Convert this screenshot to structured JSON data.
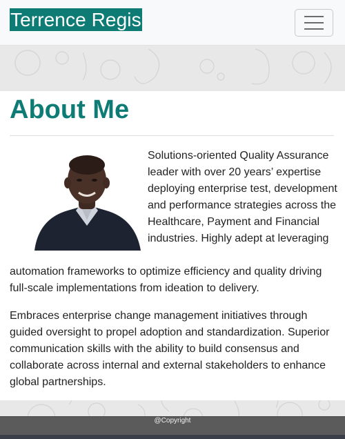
{
  "navbar": {
    "brand": "Terrence Regis",
    "menu_icon": "hamburger-menu-icon"
  },
  "about": {
    "title": "About Me",
    "paragraph1_wrap": "Solutions-oriented Quality Assurance leader with over 20 years’ expertise deploying enterprise test, development and performance strategies across the Healthcare, Payment and Financial industries. Highly adept at leveraging",
    "paragraph1_rest": "automation frameworks to optimize efficiency and quality driving full-scale implementations from ideation to delivery.",
    "paragraph2": "Embraces enterprise change management initiatives through guided oversight to propel adoption and standardization. Superior communication skills with the ability to build consensus and collaborate across internal and external stakeholders to enhance global partnerships."
  },
  "footer": {
    "copyright": "@Copyright"
  },
  "colors": {
    "brand": "#0e7b74",
    "footer": "#5b5b5b"
  }
}
